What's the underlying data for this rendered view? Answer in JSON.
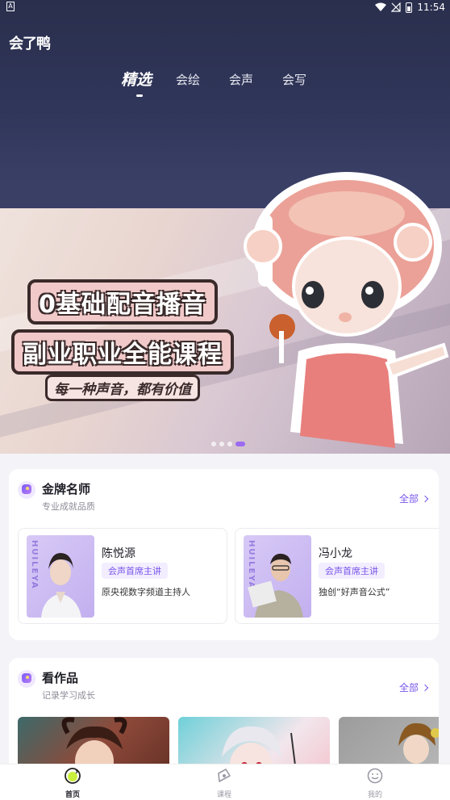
{
  "status_bar": {
    "left_badge": "A",
    "time": "11:54"
  },
  "app": {
    "logo_text": "会了鸭"
  },
  "top_tabs": [
    {
      "label": "精选",
      "active": true
    },
    {
      "label": "会绘",
      "active": false
    },
    {
      "label": "会声",
      "active": false
    },
    {
      "label": "会写",
      "active": false
    }
  ],
  "banner": {
    "line1": "0基础配音播音",
    "line2": "副业职业全能课程",
    "tagline": "每一种声音，都有价值",
    "page_count": 4,
    "active_index": 2
  },
  "teachers_section": {
    "title": "金牌名师",
    "subtitle": "专业成就品质",
    "see_all": "全部",
    "photo_watermark": "HUILEYA",
    "teachers": [
      {
        "name": "陈悦源",
        "tag": "会声首席主讲",
        "desc": "原央视数字频道主持人"
      },
      {
        "name": "冯小龙",
        "tag": "会声首席主讲",
        "desc": "独创“好声音公式”"
      }
    ]
  },
  "works_section": {
    "title": "看作品",
    "subtitle": "记录学习成长",
    "see_all": "全部"
  },
  "bottom_nav": [
    {
      "label": "首页",
      "icon": "home-icon",
      "active": true
    },
    {
      "label": "课程",
      "icon": "course-icon",
      "active": false
    },
    {
      "label": "我的",
      "icon": "profile-icon",
      "active": false
    }
  ],
  "colors": {
    "accent": "#7a56ea",
    "header_bg": "#2a2f4d",
    "page_bg": "#f4f4f8"
  }
}
